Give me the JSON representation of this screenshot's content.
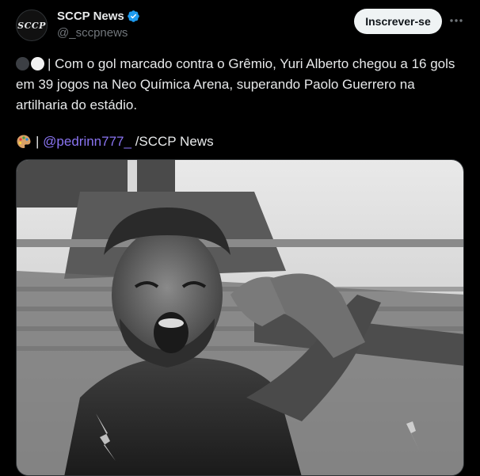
{
  "account": {
    "avatar_text": "SCCP",
    "display_name": "SCCP News",
    "handle": "@_sccpnews",
    "verified": true,
    "verified_color": "#1d9bf0"
  },
  "actions": {
    "subscribe_label": "Inscrever-se",
    "more_icon": "more-horizontal-icon"
  },
  "tweet": {
    "emoji_lead": [
      "dark-circle",
      "white-circle"
    ],
    "body": "| Com o gol marcado contra o Grêmio, Yuri Alberto chegou a 16 gols em 39 jogos na Neo Química Arena, superando Paolo Guerrero na artilharia do estádio.",
    "credit_emoji": "artist-palette",
    "credit_separator": "|",
    "mention": "@pedrinn777_",
    "credit_suffix": "/SCCP News"
  },
  "media": {
    "subject": "player-celebration-photo",
    "colors": {
      "mention": "#8a74f2",
      "text": "#e7e9ea",
      "muted": "#71767b"
    }
  }
}
